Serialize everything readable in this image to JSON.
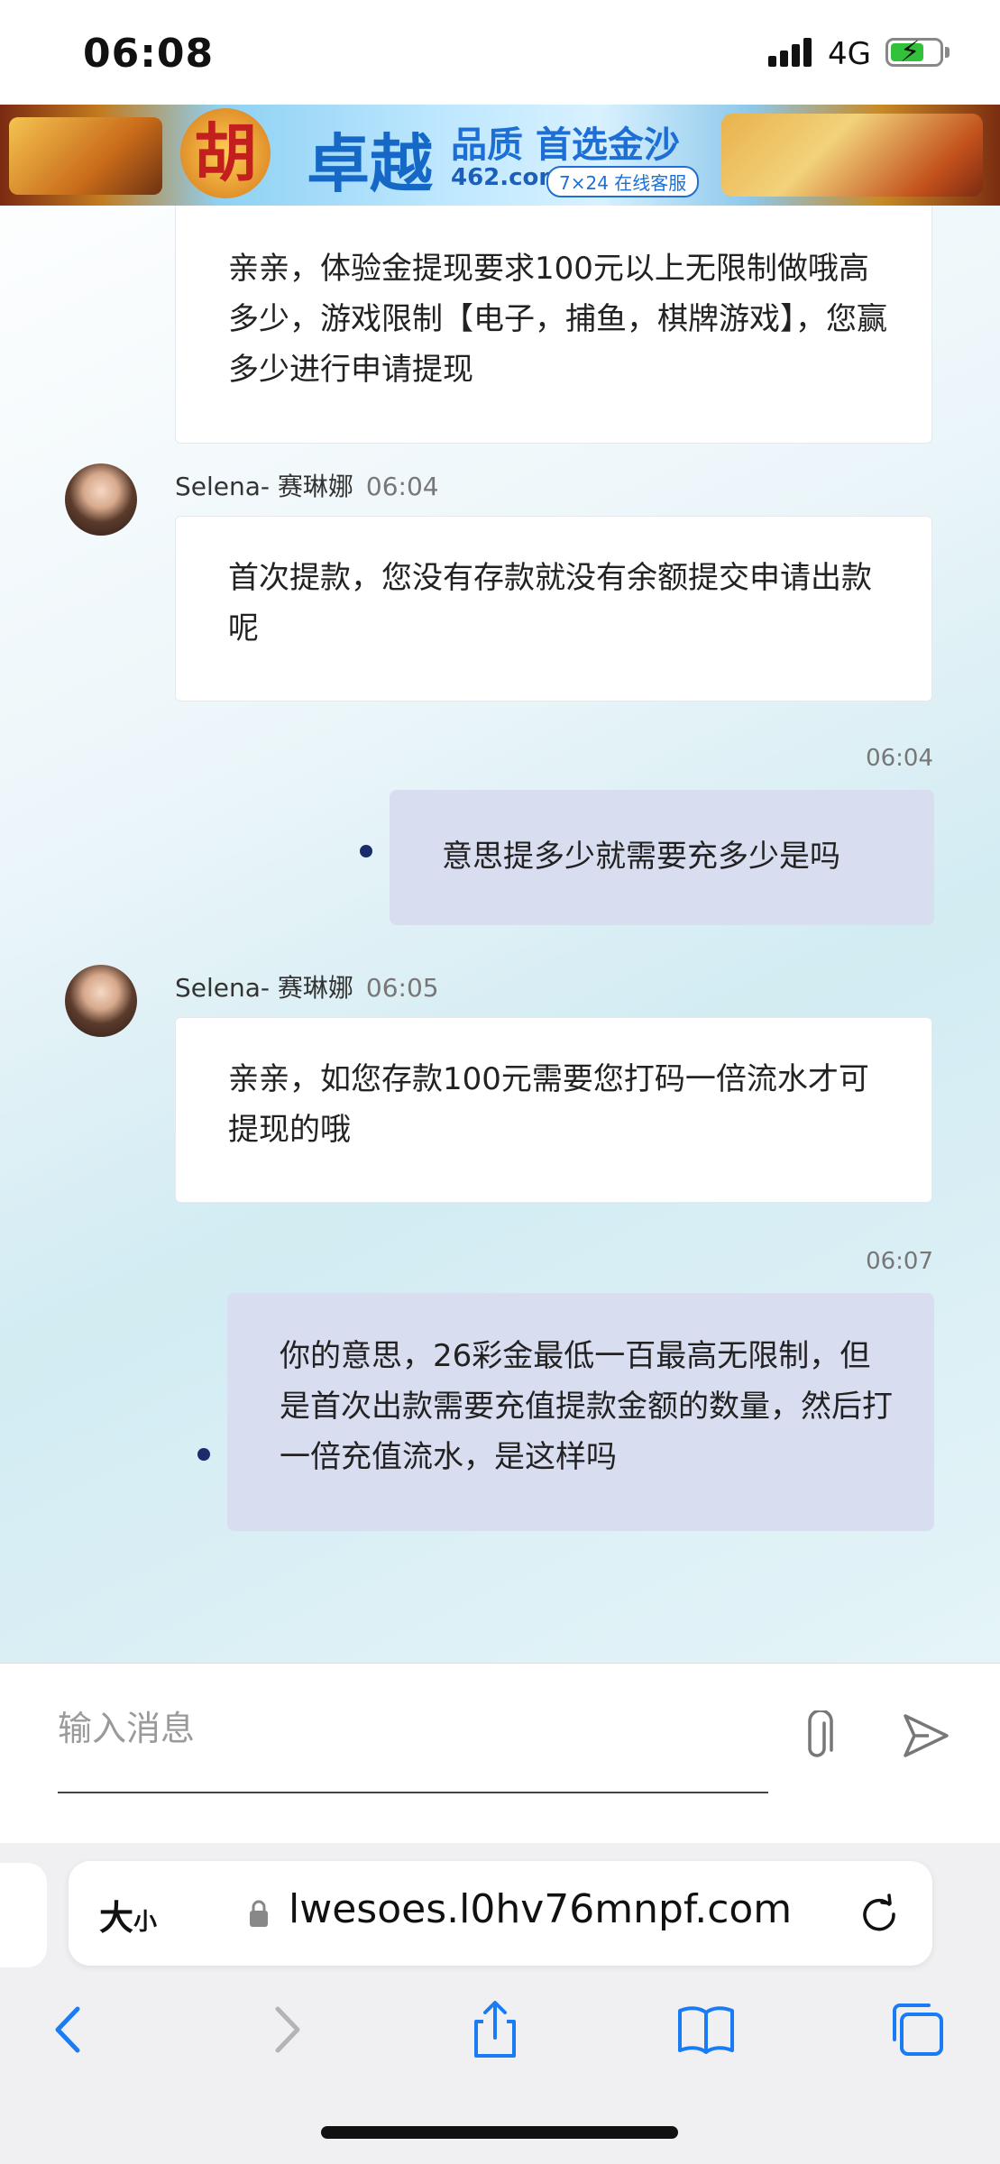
{
  "status_bar": {
    "time": "06:08",
    "network": "4G"
  },
  "banner": {
    "logo_char": "胡",
    "brand": "卓越",
    "slogan": "品质 首选金沙",
    "domain": "462.com",
    "service": "7×24 在线客服"
  },
  "chat": {
    "messages": [
      {
        "type": "in",
        "text": "亲亲，体验金提现要求100元以上无限制做哦高多少，游戏限制【电子，捕鱼，棋牌游戏】，您赢多少进行申请提现"
      },
      {
        "type": "in",
        "sender": "Selena- 赛琳娜",
        "time": "06:04",
        "text": "首次提款，您没有存款就没有余额提交申请出款呢"
      },
      {
        "type": "out",
        "time": "06:04",
        "text": "意思提多少就需要充多少是吗"
      },
      {
        "type": "in",
        "sender": "Selena- 赛琳娜",
        "time": "06:05",
        "text": "亲亲，如您存款100元需要您打码一倍流水才可提现的哦"
      },
      {
        "type": "out",
        "time": "06:07",
        "text": "你的意思，26彩金最低一百最高无限制，但是首次出款需要充值提款金额的数量，然后打一倍充值流水，是这样吗"
      }
    ]
  },
  "input": {
    "placeholder": "输入消息"
  },
  "browser": {
    "text_size": "大",
    "text_size_small": "小",
    "url": "lwesoes.l0hv76mnpf.com"
  },
  "colors": {
    "outgoing_bubble": "#d9ddf0",
    "unread_dot": "#1a2c6b",
    "accent": "#1a7cf5"
  }
}
